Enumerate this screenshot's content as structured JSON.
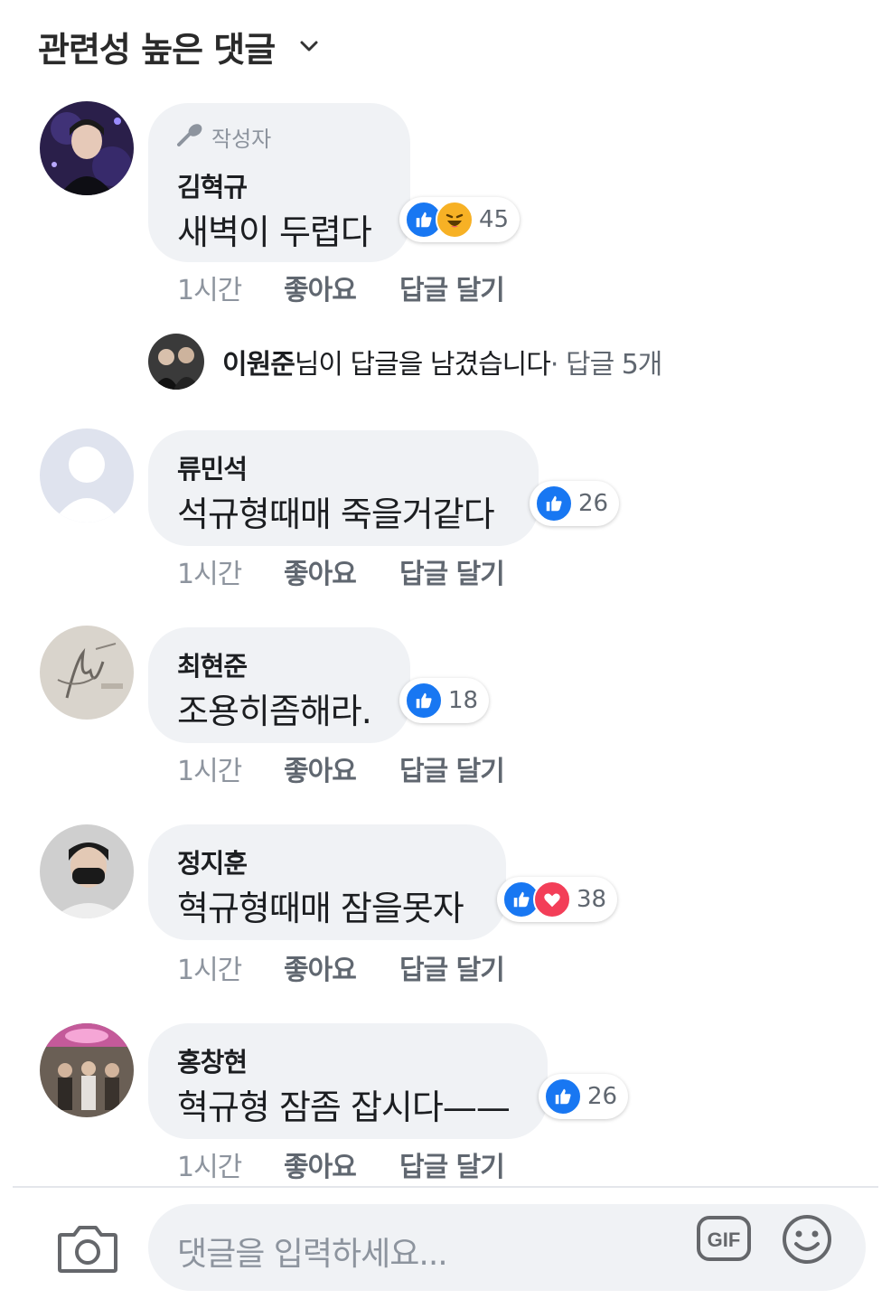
{
  "header": {
    "sort_label": "관련성 높은 댓글"
  },
  "comments": [
    {
      "author_badge": "작성자",
      "name": "김혁규",
      "text": "새벽이 두렵다",
      "reaction_count": "45",
      "time": "1시간",
      "like_label": "좋아요",
      "reply_label": "답글 달기"
    },
    {
      "name": "류민석",
      "text": "석규형때매 죽을거같다",
      "reaction_count": "26",
      "time": "1시간",
      "like_label": "좋아요",
      "reply_label": "답글 달기"
    },
    {
      "name": "최현준",
      "text": "조용히좀해라.",
      "reaction_count": "18",
      "time": "1시간",
      "like_label": "좋아요",
      "reply_label": "답글 달기"
    },
    {
      "name": "정지훈",
      "text": "혁규형때매 잠을못자",
      "reaction_count": "38",
      "time": "1시간",
      "like_label": "좋아요",
      "reply_label": "답글 달기"
    },
    {
      "name": "홍창현",
      "text": "혁규형 잠좀 잡시다——",
      "reaction_count": "26",
      "time": "1시간",
      "like_label": "좋아요",
      "reply_label": "답글 달기"
    }
  ],
  "reply_summary": {
    "name": "이원준",
    "text": "님이 답글을 남겼습니다",
    "meta": " · 답글 5개"
  },
  "composer": {
    "placeholder": "댓글을 입력하세요...",
    "gif_label": "GIF"
  },
  "colors": {
    "like_blue": "#1877f2",
    "love_red": "#f33e58",
    "haha_yellow": "#f7b125",
    "bubble_bg": "#f0f2f5"
  }
}
